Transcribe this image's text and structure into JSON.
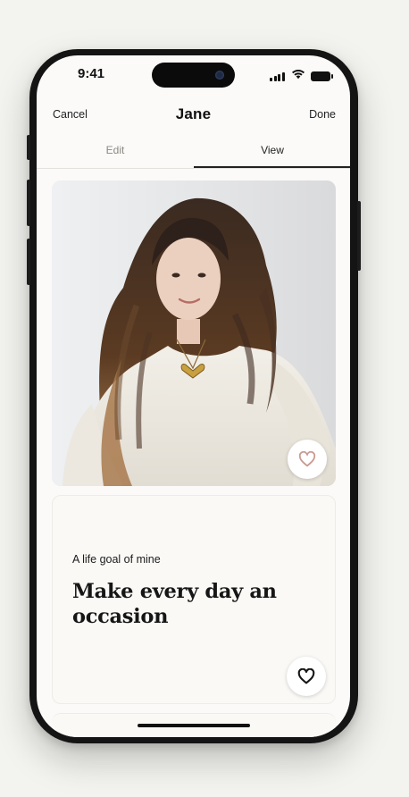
{
  "status_bar": {
    "time": "9:41"
  },
  "nav": {
    "cancel_label": "Cancel",
    "title": "Jane",
    "done_label": "Done"
  },
  "tabs": [
    {
      "label": "Edit",
      "active": false
    },
    {
      "label": "View",
      "active": true
    }
  ],
  "profile": {
    "photo": {
      "alt": "Portrait of woman with long curly hair in white top"
    }
  },
  "prompt": {
    "label": "A life goal of mine",
    "answer": "Make every day an occasion"
  },
  "icons": {
    "like_photo": "heart-icon",
    "like_prompt": "heart-icon",
    "signal": "signal-icon",
    "wifi": "wifi-icon",
    "battery": "battery-icon"
  },
  "colors": {
    "background": "#f3f3ef",
    "screen": "#fbfaf8",
    "heart_muted": "#c99b91",
    "text": "#161616"
  }
}
